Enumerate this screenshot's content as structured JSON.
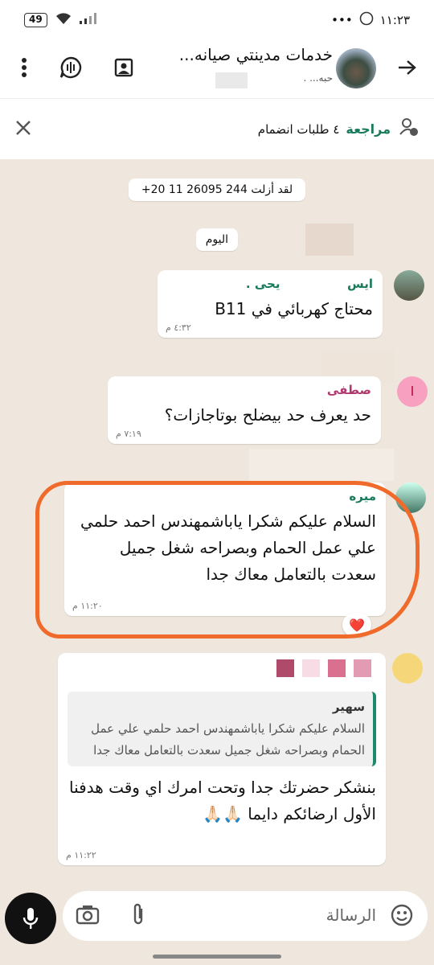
{
  "status_bar": {
    "battery": "49",
    "time": "١١:٢٣",
    "dots": "•••"
  },
  "header": {
    "group_name": "خدمات مدينتي صيانه...",
    "group_sub": "حبه...  .",
    "back_icon": "arrow-right-icon",
    "more_icon": "dots-vertical-icon"
  },
  "banner": {
    "review_label": "مراجعة",
    "requests_text": "٤ طلبات انضمام"
  },
  "messages": {
    "system_notice": "لقد أزلت 244 26095 11 20+",
    "date_pill": "اليوم",
    "m1": {
      "sender": "ايس",
      "sender2": "يحى .",
      "text": "محتاج كهربائي في B11",
      "time": "٤:٣٢ م"
    },
    "m2": {
      "avatar_letter": "ا",
      "sender": "صطفى",
      "text": "حد يعرف حد بيضلح بوتاجازات؟",
      "time": "٧:١٩ م"
    },
    "m3": {
      "sender": "ميره",
      "text": "السلام عليكم شكرا ياباشمهندس احمد حلمي علي عمل الحمام وبصراحه شغل جميل سعدت بالتعامل معاك جدا",
      "time": "١١:٢٠ م",
      "reaction": "❤️"
    },
    "m4": {
      "quote_sender": "سهير",
      "quote_text": "السلام عليكم شكرا ياباشمهندس احمد حلمي علي عمل الحمام وبصراحه شغل جميل سعدت بالتعامل معاك جدا",
      "text": "بنشكر حضرتك جدا وتحت امرك اي وقت هدفنا الأول ارضائكم دايما 🙏🏻🙏🏻",
      "time": "١١:٢٢ م"
    }
  },
  "input": {
    "placeholder": "الرسالة"
  }
}
